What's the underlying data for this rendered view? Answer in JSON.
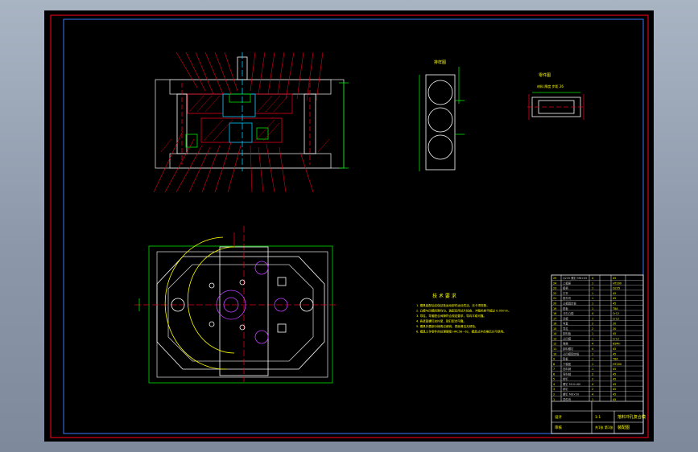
{
  "sheet": {
    "technical_requirements_title": "技 术 要 求",
    "technical_requirements": [
      "1. 模具装配后应保证各运动部件运动灵活，无卡滞现象。",
      "2. 凸模与凹模间隙均匀，装配后用试片检查，冲裁毛刺不超过 0.05mm。",
      "3. 导柱、导套配合间隙符合规定要求，导向平稳可靠。",
      "4. 各紧固螺钉应拧紧，销钉配合可靠。",
      "5. 模具外露部分棱角应倒钝，表面清洁无锈蚀。",
      "6. 模具工作零件热处理硬度 HRC58~62，模具试冲合格后方可使用。"
    ]
  },
  "detail_views": {
    "part_view_label": "零件图",
    "layout_view_label": "排样图",
    "layout_view_note": "材料 厚度  步距 26"
  },
  "title_block": {
    "drawing_title": "落料冲孔复合模",
    "subtitle": "装配图",
    "scale": "1:1",
    "sheet_no": "共1张 第1张",
    "designer_label": "设计",
    "checker_label": "审核"
  },
  "bom_rows": [
    {
      "no": "25",
      "name": "Q235 螺钉 M8×45",
      "qty": "4",
      "material": "45"
    },
    {
      "no": "24",
      "name": "上模座",
      "qty": "1",
      "material": "HT200"
    },
    {
      "no": "23",
      "name": "模柄",
      "qty": "1",
      "material": "Q235"
    },
    {
      "no": "22",
      "name": "打杆",
      "qty": "1",
      "material": "45"
    },
    {
      "no": "21",
      "name": "推件块",
      "qty": "1",
      "material": "45"
    },
    {
      "no": "20",
      "name": "凸模固定板",
      "qty": "1",
      "material": "45"
    },
    {
      "no": "19",
      "name": "垫板",
      "qty": "1",
      "material": "T8A"
    },
    {
      "no": "18",
      "name": "冲孔凸模",
      "qty": "4",
      "material": "Cr12"
    },
    {
      "no": "17",
      "name": "凹模",
      "qty": "1",
      "material": "Cr12"
    },
    {
      "no": "16",
      "name": "导套",
      "qty": "2",
      "material": "20"
    },
    {
      "no": "15",
      "name": "导柱",
      "qty": "2",
      "material": "20"
    },
    {
      "no": "14",
      "name": "卸料板",
      "qty": "1",
      "material": "45"
    },
    {
      "no": "13",
      "name": "凸凹模",
      "qty": "1",
      "material": "Cr12"
    },
    {
      "no": "12",
      "name": "弹簧",
      "qty": "4",
      "material": "65Mn"
    },
    {
      "no": "11",
      "name": "卸料螺钉",
      "qty": "4",
      "material": "45"
    },
    {
      "no": "10",
      "name": "凸凹模固定板",
      "qty": "1",
      "material": "45"
    },
    {
      "no": "9",
      "name": "垫板",
      "qty": "1",
      "material": "T8A"
    },
    {
      "no": "8",
      "name": "下模座",
      "qty": "1",
      "material": "HT200"
    },
    {
      "no": "7",
      "name": "挡料销",
      "qty": "1",
      "material": "45"
    },
    {
      "no": "6",
      "name": "导料销",
      "qty": "2",
      "material": "45"
    },
    {
      "no": "5",
      "name": "销钉",
      "qty": "2",
      "material": "45"
    },
    {
      "no": "4",
      "name": "螺钉 M10×60",
      "qty": "4",
      "material": "45"
    },
    {
      "no": "3",
      "name": "销钉",
      "qty": "2",
      "material": "45"
    },
    {
      "no": "2",
      "name": "螺钉 M8×50",
      "qty": "4",
      "material": "45"
    },
    {
      "no": "1",
      "name": "顶件块",
      "qty": "1",
      "material": "45"
    }
  ]
}
